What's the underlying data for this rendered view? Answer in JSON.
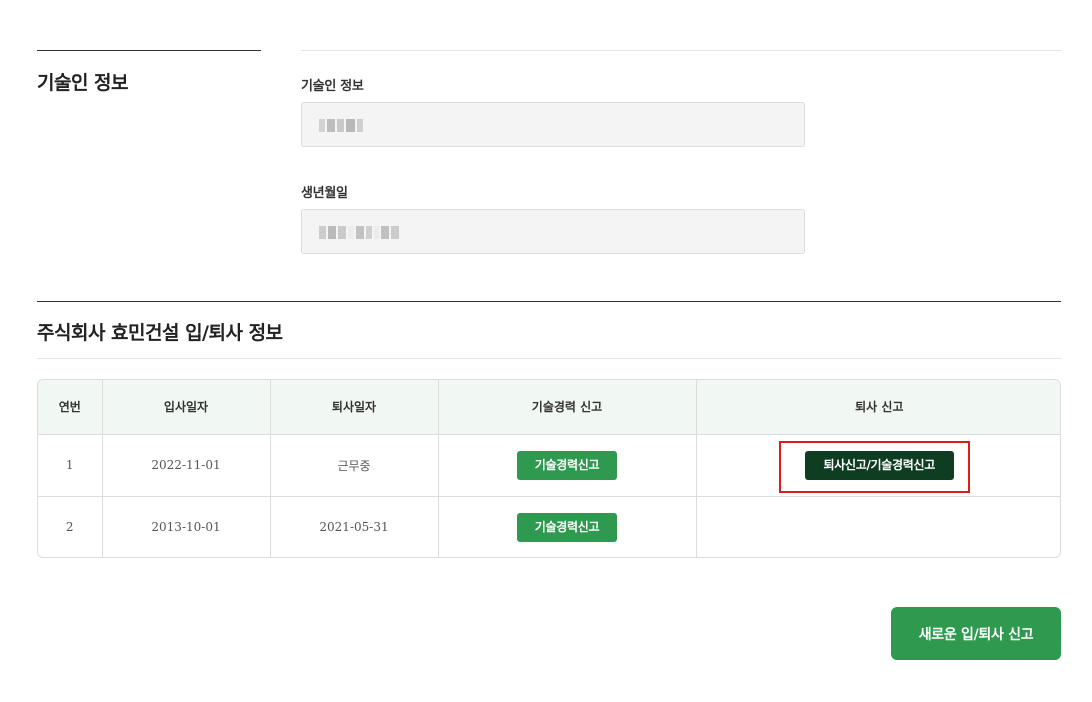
{
  "technician_section": {
    "title": "기술인 정보",
    "name_field": {
      "label": "기술인 정보"
    },
    "birth_field": {
      "label": "생년월일"
    }
  },
  "employment_section": {
    "title": "주식회사 효민건설 입/퇴사 정보",
    "columns": [
      "연번",
      "입사일자",
      "퇴사일자",
      "기술경력 신고",
      "퇴사 신고"
    ],
    "rows": [
      {
        "no": "1",
        "join_date": "2022-11-01",
        "leave_date": "근무중",
        "career_button": "기술경력신고",
        "resign_button": "퇴사신고/기술경력신고"
      },
      {
        "no": "2",
        "join_date": "2013-10-01",
        "leave_date": "2021-05-31",
        "career_button": "기술경력신고",
        "resign_button": ""
      }
    ]
  },
  "new_entry_button": "새로운 입/퇴사 신고",
  "colors": {
    "primary_green": "#2f9a4f",
    "dark_green": "#0f3d22",
    "highlight_red": "#e01b1b",
    "header_bg": "#f1f7f3"
  }
}
